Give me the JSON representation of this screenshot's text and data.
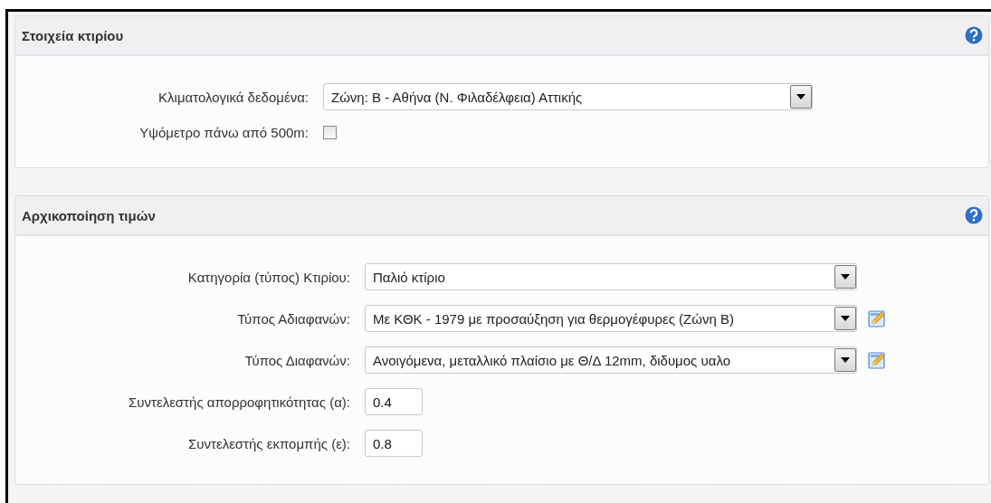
{
  "panels": [
    {
      "title": "Στοιχεία κτιρίου",
      "help": true,
      "rows": [
        {
          "kind": "select",
          "label": "Κλιματολογικά δεδομένα:",
          "value": "Ζώνη: Β - Αθήνα (Ν. Φιλαδέλφεια) Αττικής",
          "edit_button": false
        },
        {
          "kind": "checkbox",
          "label": "Υψόμετρο πάνω από 500m:",
          "checked": false
        }
      ]
    },
    {
      "title": "Αρχικοποίηση τιμών",
      "help": true,
      "rows": [
        {
          "kind": "select",
          "label": "Κατηγορία (τύπος) Κτιρίου:",
          "value": "Παλιό κτίριο",
          "edit_button": false
        },
        {
          "kind": "select",
          "label": "Τύπος Αδιαφανών:",
          "value": "Με ΚΘΚ - 1979 με προσαύξηση για θερμογέφυρες (Ζώνη Β)",
          "edit_button": true
        },
        {
          "kind": "select",
          "label": "Τύπος Διαφανών:",
          "value": "Ανοιγόμενα, μεταλλικό πλαίσιο με Θ/Δ 12mm, διδυμος υαλο",
          "edit_button": true
        },
        {
          "kind": "text",
          "label": "Συντελεστής απορροφητικότητας (α):",
          "value": "0.4"
        },
        {
          "kind": "text",
          "label": "Συντελεστής εκπομπής (ε):",
          "value": "0.8"
        }
      ]
    }
  ]
}
